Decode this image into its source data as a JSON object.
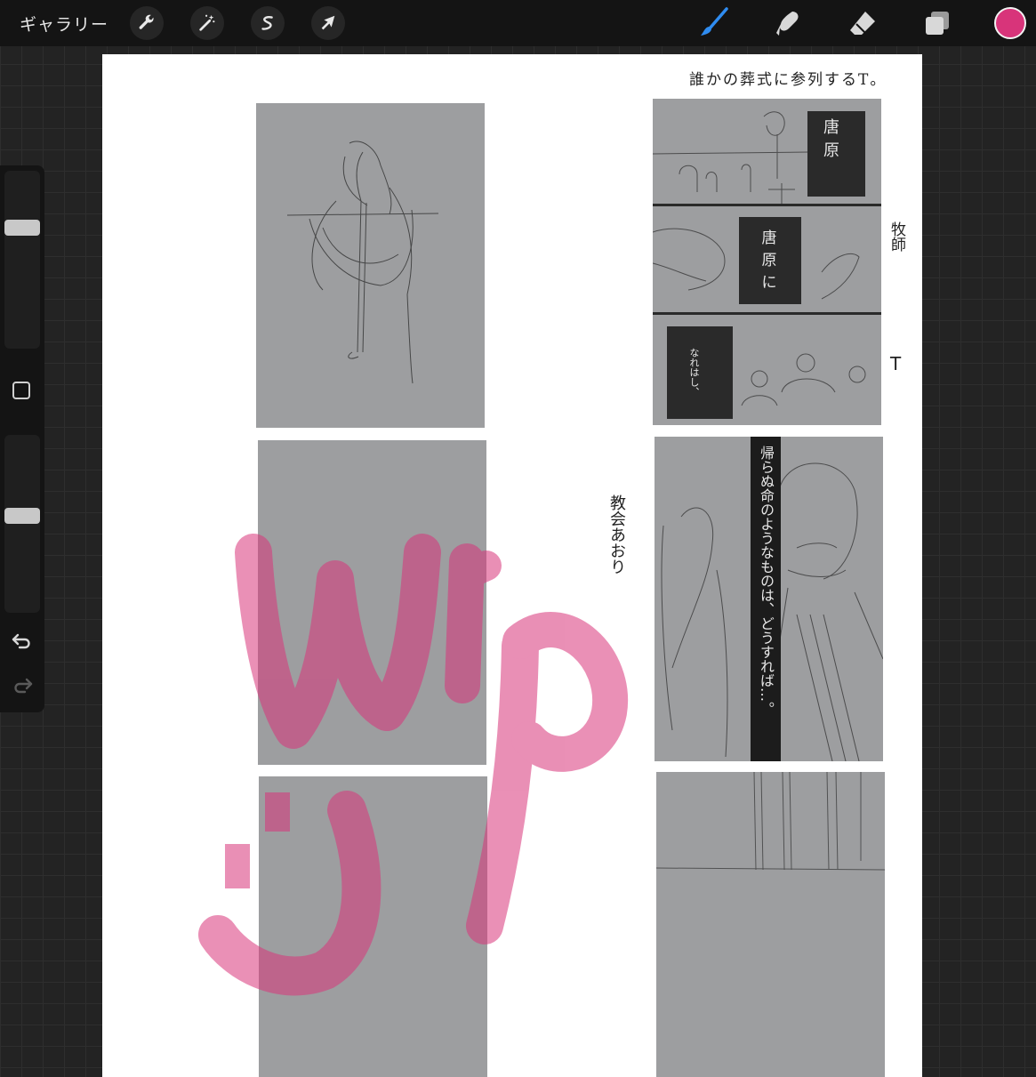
{
  "topbar": {
    "gallery_label": "ギャラリー",
    "left_tools": [
      "wrench-icon",
      "magic-wand-icon",
      "selection-icon",
      "transform-arrow-icon"
    ],
    "right_tools": [
      "brush-icon",
      "smudge-icon",
      "eraser-icon",
      "layers-icon"
    ],
    "active_tool": "brush-icon",
    "colors": {
      "bar": "#141414",
      "active_brush": "#2f8cf0",
      "current_color": "#d8347a"
    }
  },
  "sidebar": {
    "brush_size_level": 0.7,
    "opacity_level": 0.55,
    "icons": [
      "modify-square-icon",
      "undo-icon",
      "redo-icon"
    ]
  },
  "canvas": {
    "annotations": {
      "top_right_caption": "誰かの葬式に参列するT。",
      "panel_side_1": "牧師",
      "panel_side_2": "T",
      "middle_vertical": "教会あおり"
    },
    "speech": {
      "bubble_1": [
        "唐",
        "原"
      ],
      "bubble_2": [
        "唐",
        "原",
        "に"
      ],
      "bubble_3": "なれはし、",
      "bubble_vertical": "帰らぬ命のようなものは、どうすれば…。"
    },
    "overlay_text": "WIP",
    "overlay_color": "#d8347a"
  }
}
